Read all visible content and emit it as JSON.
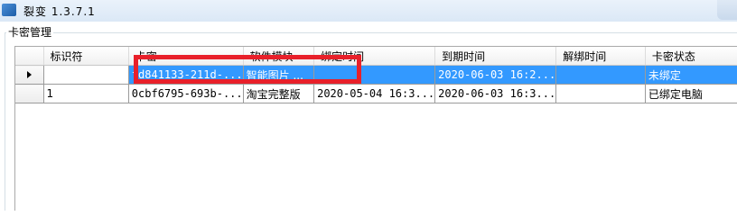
{
  "window": {
    "title": "裂变  1.3.7.1"
  },
  "group": {
    "label": "卡密管理"
  },
  "grid": {
    "columns": [
      "标识符",
      "卡密",
      "软件模块",
      "绑定时间",
      "到期时间",
      "解绑时间",
      "卡密状态"
    ],
    "rows": [
      {
        "id": "",
        "key": "fd841133-211d-...",
        "module": "智能图片 ...",
        "bind_time": "",
        "expire_time": "2020-06-03 16:2...",
        "unbind_time": "",
        "status": "未绑定",
        "selected": true
      },
      {
        "id": "1",
        "key": "0cbf6795-693b-...",
        "module": "淘宝完整版",
        "bind_time": "2020-05-04 16:3...",
        "expire_time": "2020-06-03 16:3...",
        "unbind_time": "",
        "status": "已绑定电脑",
        "selected": false
      }
    ]
  },
  "colors": {
    "selection": "#3399ff",
    "annotation": "#e8202a"
  }
}
